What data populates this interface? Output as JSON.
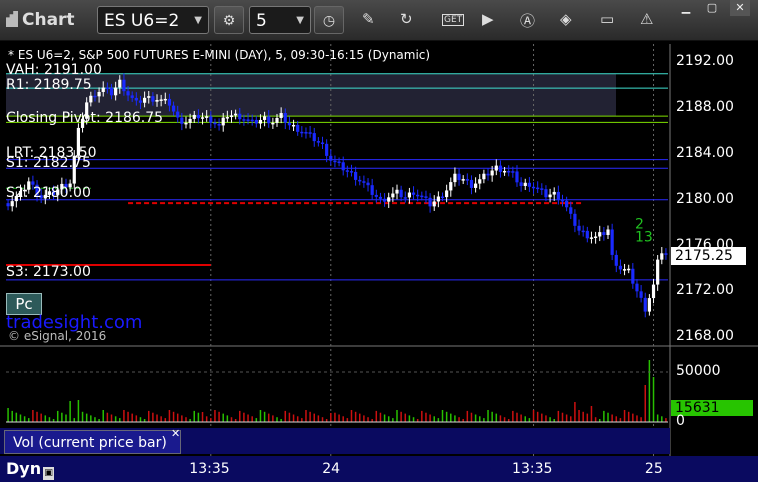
{
  "window": {
    "title": "Chart",
    "symbol": "ES U6=2",
    "interval": "5",
    "window_controls": [
      "minimize-icon",
      "maximize-icon",
      "close-icon"
    ]
  },
  "toolbar_icons": [
    "gear-icon",
    "clock-icon",
    "pencil-icon",
    "refresh-icon",
    "get-icon",
    "play-icon",
    "a-icon",
    "eraser-icon",
    "comment-icon",
    "warning-icon"
  ],
  "chart_header": "* ES U6=2, S&P 500 FUTURES E-MINI (DAY), 5, 09:30-16:15 (Dynamic)",
  "levels": {
    "vah": "VAH: 2191.00",
    "r1": "R1: 2189.75",
    "closing_pivot": "Closing Pivot: 2186.75",
    "lrt": "LRT: 2183.50",
    "s1": "S1: 2182.75",
    "s2": "S2: 2180.00",
    "s3": "S3: 2173.00"
  },
  "pc_label": "Pc",
  "brand": "tradesight.com",
  "copyright": "© eSignal, 2016",
  "volume_panel_label": "Vol (current price bar)",
  "volume_badge": "15631",
  "last_price": "2175.25",
  "dyn_label": "Dyn",
  "annotations": [
    "2",
    "13"
  ],
  "colors": {
    "up_bar": "#ffffff",
    "down_bar": "#1a2aff",
    "vol_up": "#28c000",
    "vol_down": "#cc1010",
    "pivot_line": "#7fe000",
    "r1_line": "#40e0d0",
    "s_line": "#2a2aff",
    "red_line": "#e00000"
  },
  "chart_data": {
    "type": "candlestick",
    "title": "* ES U6=2, S&P 500 FUTURES E-MINI (DAY), 5, 09:30-16:15 (Dynamic)",
    "yticks": [
      "2192.00",
      "2188.00",
      "2184.00",
      "2180.00",
      "2176.00",
      "2172.00",
      "2168.00"
    ],
    "ylim": [
      2167.4,
      2193.6
    ],
    "xticks": [
      {
        "label": "13:35",
        "bar": 49
      },
      {
        "label": "24",
        "bar": 78
      },
      {
        "label": "13:35",
        "bar": 127
      },
      {
        "label": "25",
        "bar": 156
      }
    ],
    "horizontal_levels": [
      {
        "name": "VAH",
        "value": 2191.0
      },
      {
        "name": "R1",
        "value": 2189.75
      },
      {
        "name": "Closing Pivot",
        "value": 2186.75
      },
      {
        "name": "LRT",
        "value": 2183.5
      },
      {
        "name": "S1",
        "value": 2182.75
      },
      {
        "name": "S2",
        "value": 2180.0
      },
      {
        "name": "S3",
        "value": 2173.0
      }
    ],
    "price_path": [
      [
        0,
        2179.7
      ],
      [
        3,
        2180.5
      ],
      [
        5,
        2181.6
      ],
      [
        8,
        2180.2
      ],
      [
        11,
        2180.6
      ],
      [
        13,
        2181.2
      ],
      [
        15,
        2181.5
      ],
      [
        17,
        2186.0
      ],
      [
        19,
        2188.5
      ],
      [
        21,
        2189.3
      ],
      [
        23,
        2189.7
      ],
      [
        25,
        2189.3
      ],
      [
        27,
        2190.3
      ],
      [
        29,
        2189.2
      ],
      [
        31,
        2188.4
      ],
      [
        33,
        2188.9
      ],
      [
        36,
        2188.8
      ],
      [
        39,
        2188.4
      ],
      [
        41,
        2187.0
      ],
      [
        43,
        2186.8
      ],
      [
        46,
        2187.3
      ],
      [
        49,
        2187.0
      ],
      [
        51,
        2186.4
      ],
      [
        53,
        2187.4
      ],
      [
        56,
        2187.3
      ],
      [
        59,
        2186.7
      ],
      [
        62,
        2187.1
      ],
      [
        64,
        2186.8
      ],
      [
        66,
        2187.3
      ],
      [
        68,
        2186.5
      ],
      [
        70,
        2186.2
      ],
      [
        72,
        2185.8
      ],
      [
        74,
        2185.3
      ],
      [
        76,
        2184.7
      ],
      [
        78,
        2183.5
      ],
      [
        80,
        2183.0
      ],
      [
        82,
        2182.5
      ],
      [
        84,
        2182.0
      ],
      [
        86,
        2181.4
      ],
      [
        88,
        2180.6
      ],
      [
        90,
        2179.9
      ],
      [
        92,
        2180.3
      ],
      [
        94,
        2180.6
      ],
      [
        96,
        2180.2
      ],
      [
        98,
        2180.7
      ],
      [
        100,
        2180.2
      ],
      [
        102,
        2179.6
      ],
      [
        104,
        2180.1
      ],
      [
        106,
        2180.9
      ],
      [
        108,
        2182.0
      ],
      [
        110,
        2181.8
      ],
      [
        112,
        2181.3
      ],
      [
        114,
        2181.7
      ],
      [
        116,
        2182.3
      ],
      [
        118,
        2182.8
      ],
      [
        120,
        2182.6
      ],
      [
        122,
        2182.2
      ],
      [
        124,
        2181.2
      ],
      [
        126,
        2181.4
      ],
      [
        128,
        2180.9
      ],
      [
        130,
        2180.4
      ],
      [
        132,
        2180.5
      ],
      [
        134,
        2180.0
      ],
      [
        136,
        2178.5
      ],
      [
        138,
        2177.3
      ],
      [
        140,
        2176.9
      ],
      [
        142,
        2176.7
      ],
      [
        144,
        2177.1
      ],
      [
        145,
        2177.4
      ],
      [
        146,
        2175.0
      ],
      [
        148,
        2174.0
      ],
      [
        150,
        2173.7
      ],
      [
        152,
        2172.0
      ],
      [
        154,
        2170.5
      ],
      [
        155,
        2171.5
      ],
      [
        156,
        2172.5
      ],
      [
        157,
        2174.5
      ],
      [
        158,
        2175.5
      ],
      [
        159,
        2175.25
      ]
    ],
    "volume": {
      "ylabel_ticks": [
        "50000",
        "0"
      ],
      "ylim": [
        0,
        70000
      ],
      "last": 15631,
      "spikes": [
        [
          0,
          14000
        ],
        [
          15,
          21000
        ],
        [
          17,
          22000
        ],
        [
          23,
          12000
        ],
        [
          47,
          10000
        ],
        [
          78,
          9000
        ],
        [
          137,
          20000
        ],
        [
          141,
          16000
        ],
        [
          154,
          37000
        ],
        [
          155,
          62000
        ],
        [
          156,
          45000
        ]
      ]
    }
  }
}
